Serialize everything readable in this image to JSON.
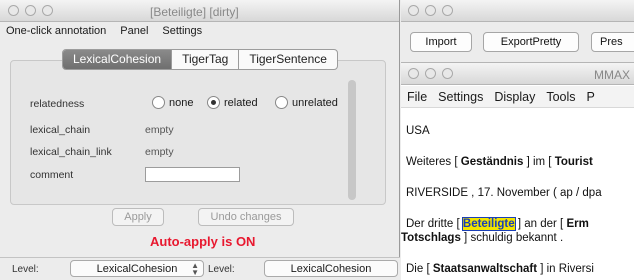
{
  "left_window": {
    "title": "[Beteiligte] [dirty]",
    "menu": [
      "One-click annotation",
      "Panel",
      "Settings"
    ],
    "tabs": [
      "LexicalCohesion",
      "TigerTag",
      "TigerSentence"
    ],
    "active_tab": "LexicalCohesion",
    "fields": {
      "relatedness_label": "relatedness",
      "relatedness_options": [
        "none",
        "related",
        "unrelated"
      ],
      "relatedness_selected": "related",
      "lexical_chain_label": "lexical_chain",
      "lexical_chain_value": "empty",
      "lexical_chain_link_label": "lexical_chain_link",
      "lexical_chain_link_value": "empty",
      "comment_label": "comment",
      "comment_value": ""
    },
    "apply_label": "Apply",
    "undo_label": "Undo changes",
    "auto_apply_text": "Auto-apply is ON",
    "level_label": "Level:",
    "level_value": "LexicalCohesion",
    "level_label2": "Level:",
    "level_value2": "LexicalCohesion"
  },
  "right_top_window": {
    "buttons": [
      "Import",
      "ExportPretty",
      "Pres"
    ]
  },
  "right_main_window": {
    "title": "MMAX",
    "menu": [
      "File",
      "Settings",
      "Display",
      "Tools",
      "P"
    ],
    "lines": {
      "l1": "USA",
      "l2a": "Weiteres [ ",
      "l2b": "Geständnis",
      "l2c": " ] im [ ",
      "l2d": "Tourist",
      "l3": "RIVERSIDE , 17. November ( ap / dpa",
      "l4a": "Der dritte [ ",
      "l4b": "Beteiligte",
      "l4c": " ] an der [ ",
      "l4d": "Erm",
      "l5a": "Totschlags",
      "l5b": " ] schuldig bekannt .",
      "l6a": "Die [ ",
      "l6b": "Staatsanwaltschaft",
      "l6c": " ] in Riversi"
    }
  },
  "colors": {
    "highlight": "#f2e500",
    "auto_apply": "#e8182f",
    "active_tab": "#777777"
  }
}
